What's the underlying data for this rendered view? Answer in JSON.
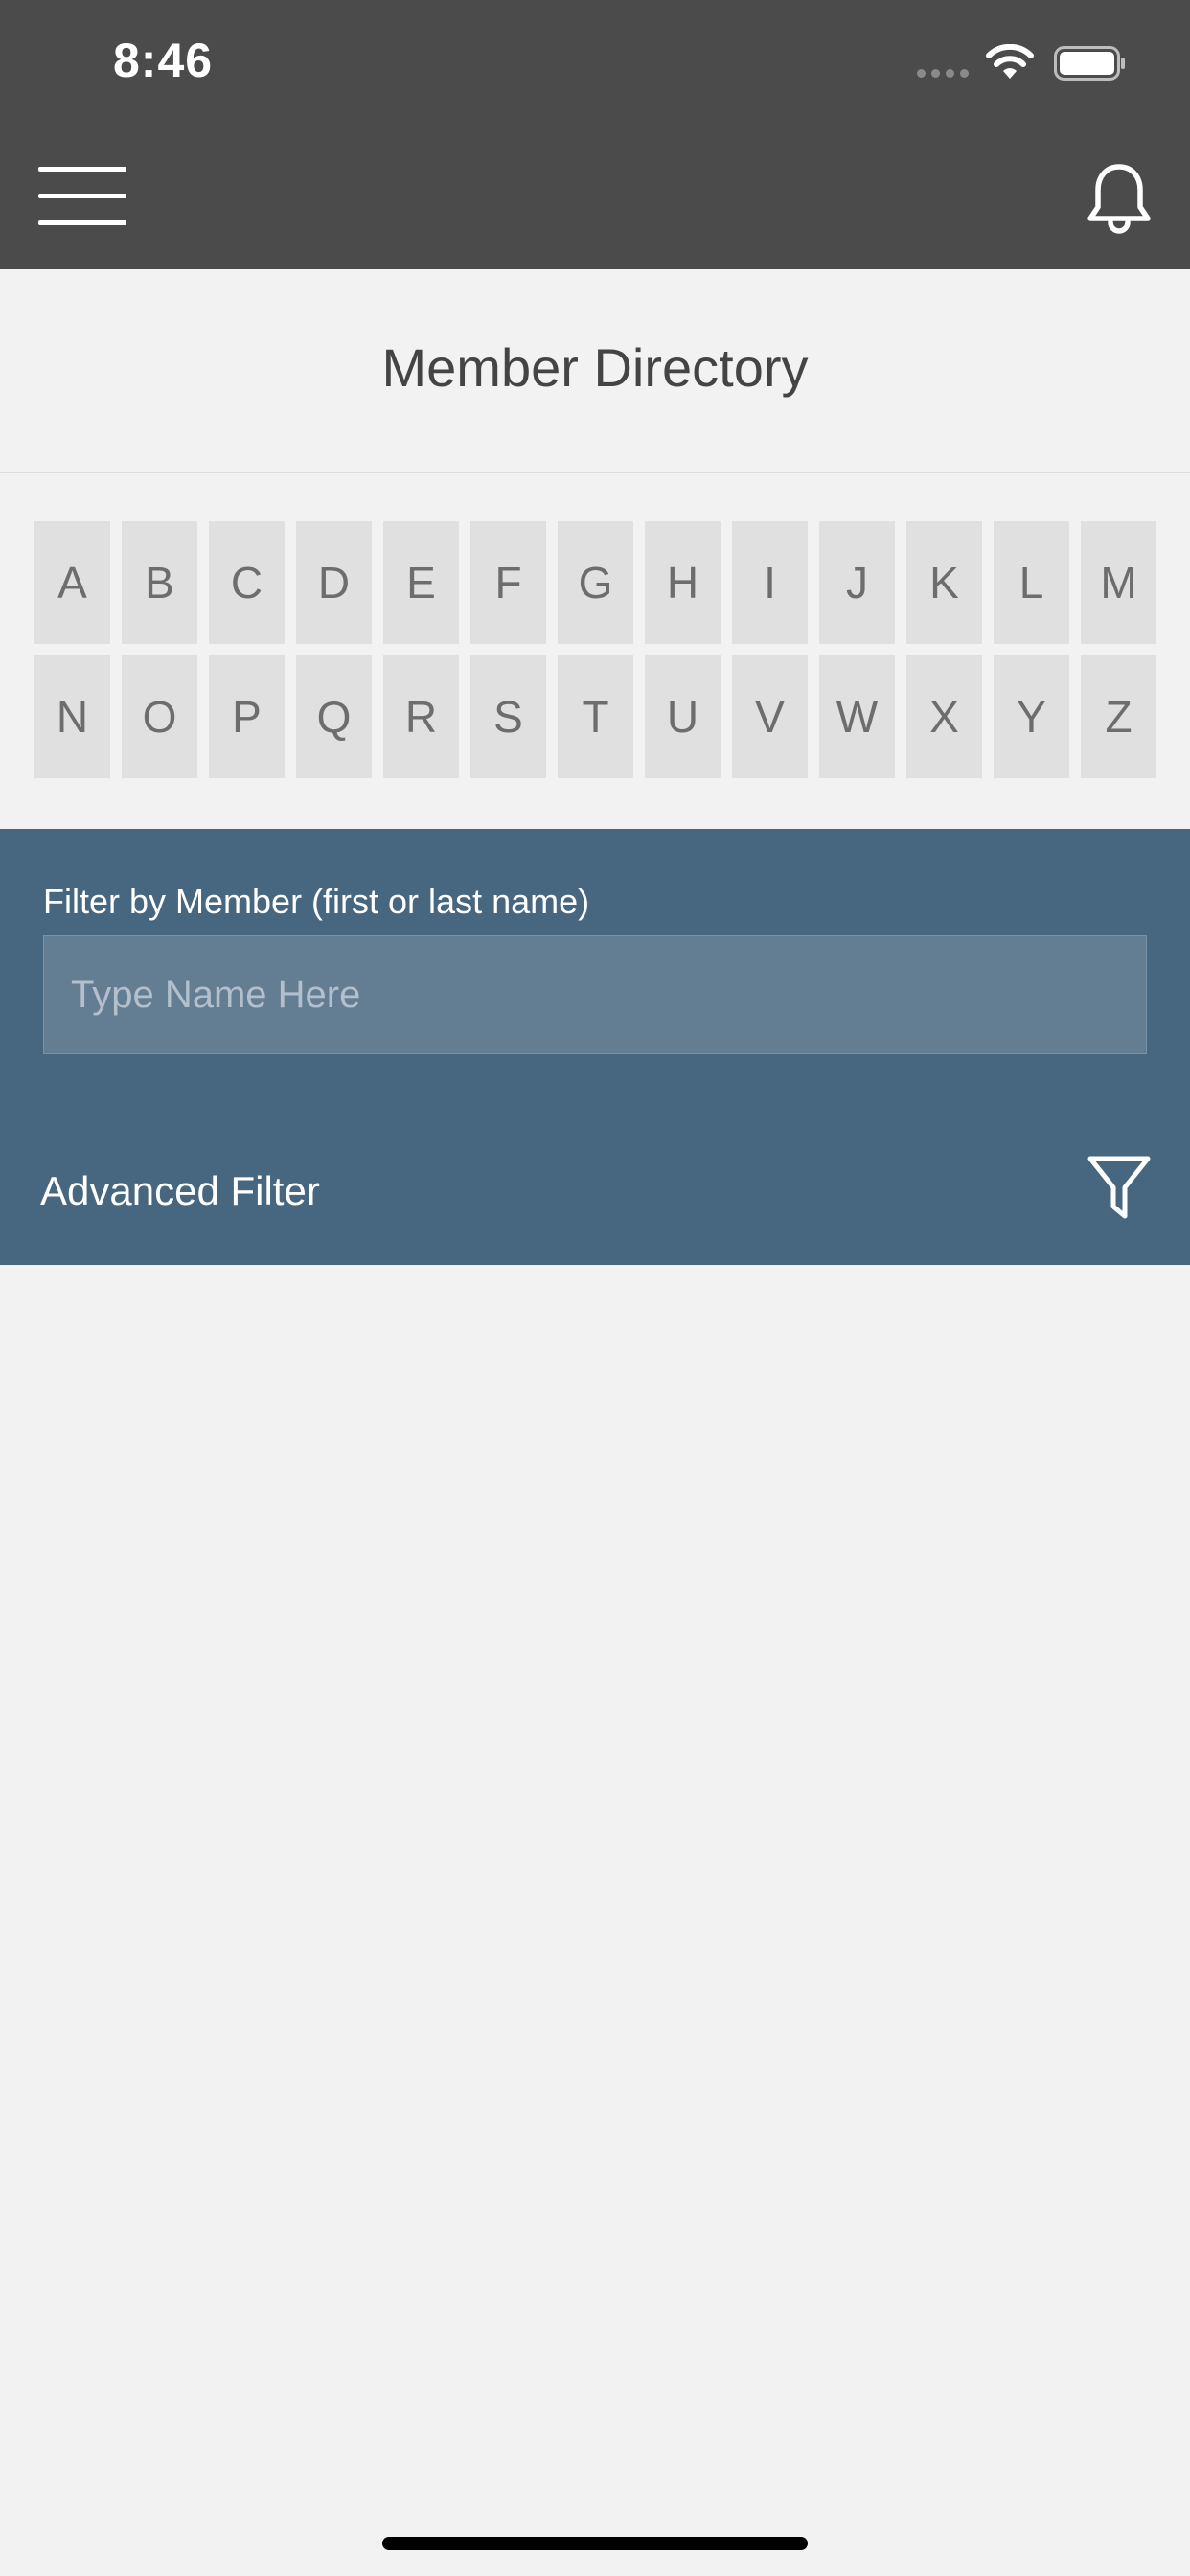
{
  "status_bar": {
    "time": "8:46"
  },
  "header": {
    "menu_icon": "hamburger-menu-icon",
    "notification_icon": "bell-icon"
  },
  "page": {
    "title": "Member Directory"
  },
  "alphabet": {
    "letters": [
      "A",
      "B",
      "C",
      "D",
      "E",
      "F",
      "G",
      "H",
      "I",
      "J",
      "K",
      "L",
      "M",
      "N",
      "O",
      "P",
      "Q",
      "R",
      "S",
      "T",
      "U",
      "V",
      "W",
      "X",
      "Y",
      "Z"
    ]
  },
  "filter": {
    "label": "Filter by Member (first or last name)",
    "value": "",
    "placeholder": "Type Name Here",
    "advanced_label": "Advanced Filter",
    "advanced_icon": "funnel-icon"
  },
  "colors": {
    "header_bg": "#4b4b4b",
    "panel_bg": "#47667f",
    "input_bg": "#637d93",
    "letter_tile_bg": "#e0e0e0",
    "page_bg": "#f2f2f2"
  }
}
